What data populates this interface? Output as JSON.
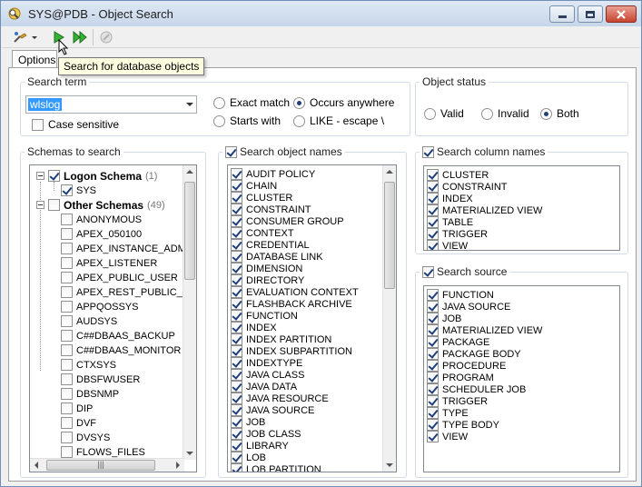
{
  "window": {
    "title": "SYS@PDB - Object Search"
  },
  "toolbar": {
    "tooltip": "Search for database objects"
  },
  "tabs": [
    {
      "label": "Options"
    }
  ],
  "search_term": {
    "title": "Search term",
    "value": "wlslog",
    "case_sensitive_label": "Case sensitive",
    "match_options": [
      {
        "label": "Exact match",
        "checked": false
      },
      {
        "label": "Occurs anywhere",
        "checked": true
      },
      {
        "label": "Starts with",
        "checked": false
      },
      {
        "label": "LIKE - escape \\",
        "checked": false
      }
    ]
  },
  "object_status": {
    "title": "Object status",
    "options": [
      {
        "label": "Valid",
        "checked": false
      },
      {
        "label": "Invalid",
        "checked": false
      },
      {
        "label": "Both",
        "checked": true
      }
    ]
  },
  "schemas": {
    "title": "Schemas to search",
    "logon_label": "Logon Schema",
    "logon_count": "(1)",
    "logon_items": [
      "SYS"
    ],
    "other_label": "Other Schemas",
    "other_count": "(49)",
    "other_items": [
      "ANONYMOUS",
      "APEX_050100",
      "APEX_INSTANCE_ADMI",
      "APEX_LISTENER",
      "APEX_PUBLIC_USER",
      "APEX_REST_PUBLIC_U",
      "APPQOSSYS",
      "AUDSYS",
      "C##DBAAS_BACKUP",
      "C##DBAAS_MONITOR",
      "CTXSYS",
      "DBSFWUSER",
      "DBSNMP",
      "DIP",
      "DVF",
      "DVSYS",
      "FLOWS_FILES"
    ]
  },
  "object_names": {
    "title": "Search object names",
    "items": [
      "AUDIT POLICY",
      "CHAIN",
      "CLUSTER",
      "CONSTRAINT",
      "CONSUMER GROUP",
      "CONTEXT",
      "CREDENTIAL",
      "DATABASE LINK",
      "DIMENSION",
      "DIRECTORY",
      "EVALUATION CONTEXT",
      "FLASHBACK ARCHIVE",
      "FUNCTION",
      "INDEX",
      "INDEX PARTITION",
      "INDEX SUBPARTITION",
      "INDEXTYPE",
      "JAVA CLASS",
      "JAVA DATA",
      "JAVA RESOURCE",
      "JAVA SOURCE",
      "JOB",
      "JOB CLASS",
      "LIBRARY",
      "LOB",
      "LOB PARTITION"
    ]
  },
  "column_names": {
    "title": "Search column names",
    "items": [
      "CLUSTER",
      "CONSTRAINT",
      "INDEX",
      "MATERIALIZED VIEW",
      "TABLE",
      "TRIGGER",
      "VIEW"
    ]
  },
  "source": {
    "title": "Search source",
    "items": [
      "FUNCTION",
      "JAVA SOURCE",
      "JOB",
      "MATERIALIZED VIEW",
      "PACKAGE",
      "PACKAGE BODY",
      "PROCEDURE",
      "PROGRAM",
      "SCHEDULER JOB",
      "TRIGGER",
      "TYPE",
      "TYPE BODY",
      "VIEW"
    ]
  }
}
